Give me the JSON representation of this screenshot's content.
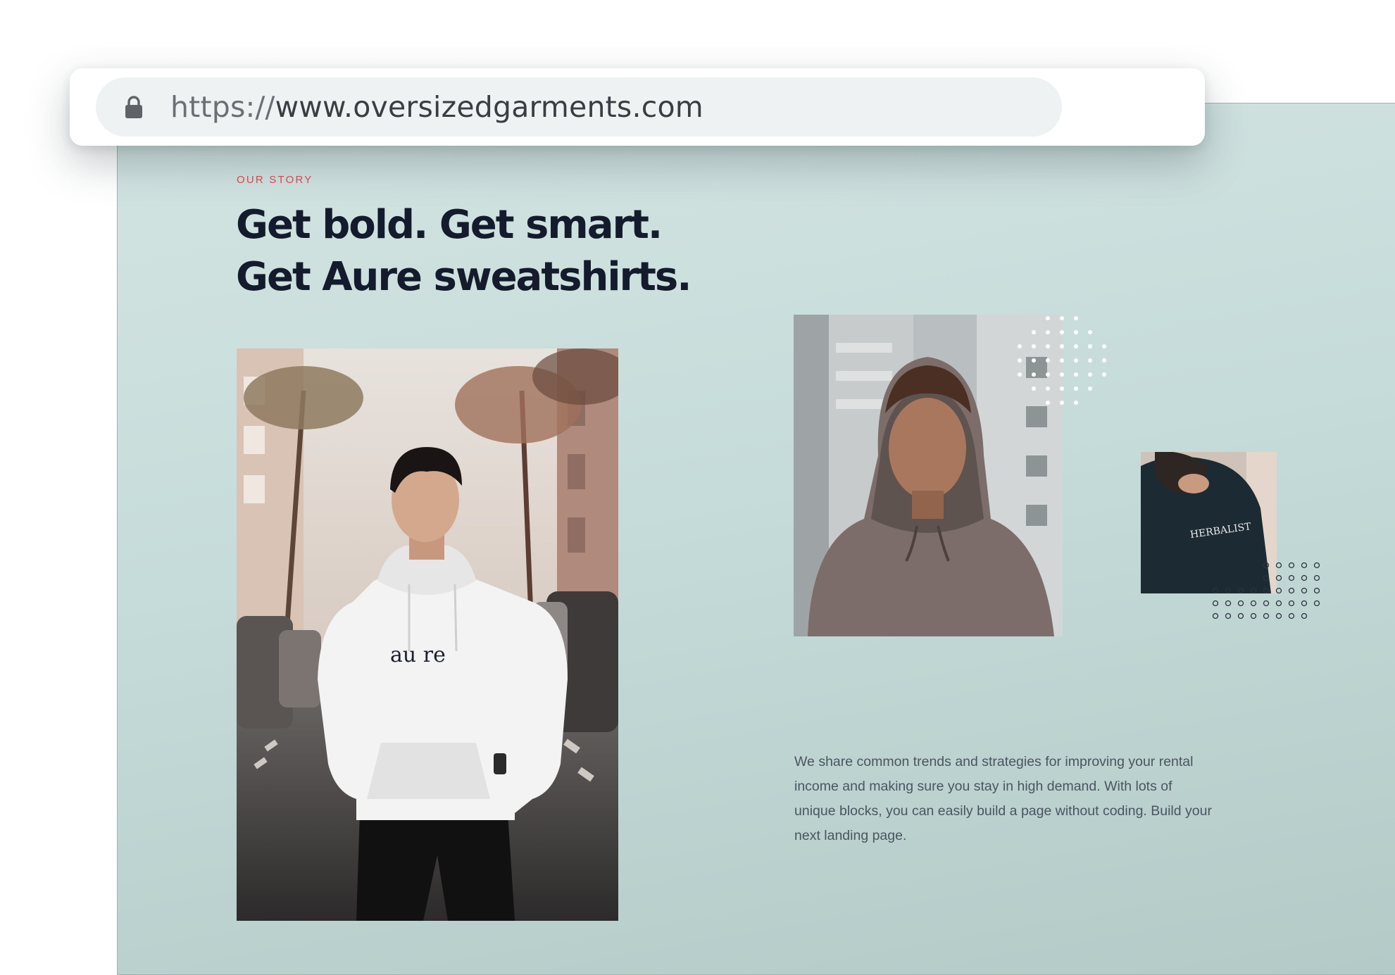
{
  "browser": {
    "url_scheme": "https://",
    "url_host": "www.oversizedgarments.com",
    "lock_icon": "lock-icon"
  },
  "story": {
    "eyebrow": "OUR STORY",
    "headline_line1": "Get bold. Get smart.",
    "headline_line2": "Get Aure sweatshirts.",
    "body": "We share common trends and strategies for improving your rental income and making sure you stay in high demand. With lots of unique blocks, you can easily build a page without coding. Build your next landing page."
  },
  "images": {
    "main_hoodie_print": "au  re",
    "small_hoodie_print": "HERBALIST"
  },
  "colors": {
    "accent": "#e5484d",
    "heading": "#141b2d",
    "body_text": "#4a5561",
    "background": "#c6dcda"
  }
}
